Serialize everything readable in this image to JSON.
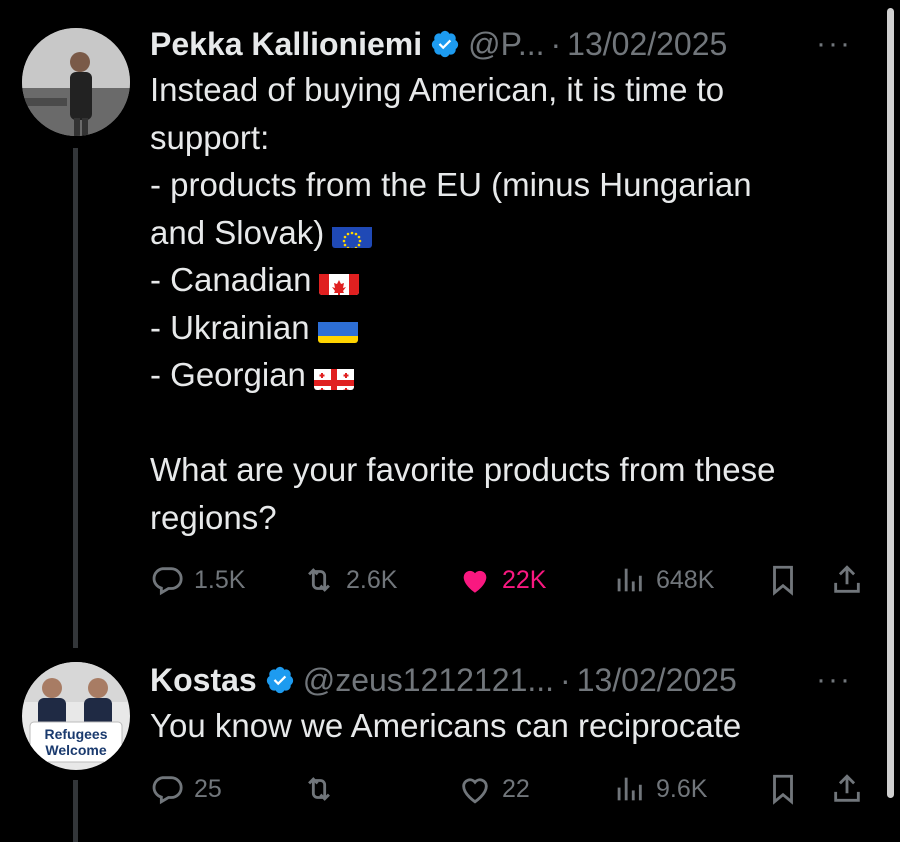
{
  "tweets": [
    {
      "name": "Pekka Kallioniemi",
      "handle": "@P...",
      "date": "13/02/2025",
      "more": "···",
      "lines": [
        "Instead of buying American, it is time to",
        "support:",
        "- products from the EU (minus Hungarian",
        "and Slovak)",
        "- Canadian",
        "- Ukrainian",
        "- Georgian",
        "",
        "What are your favorite products from these",
        "regions?"
      ],
      "replies": "1.5K",
      "reposts": "2.6K",
      "likes": "22K",
      "views": "648K",
      "liked": true
    },
    {
      "name": "Kostas",
      "handle": "@zeus1212121...",
      "date": "13/02/2025",
      "more": "···",
      "avatar_sign_line1": "Refugees",
      "avatar_sign_line2": "Welcome",
      "lines": [
        "You know we Americans can reciprocate"
      ],
      "replies": "25",
      "reposts": "",
      "likes": "22",
      "views": "9.6K",
      "liked": false
    }
  ],
  "colors": {
    "background": "#000000",
    "text": "#e7e9ea",
    "muted": "#71767b",
    "verified": "#1d9bf0",
    "like": "#f91880"
  },
  "icons": [
    "verified-badge-icon",
    "reply-icon",
    "repost-icon",
    "like-icon",
    "views-icon",
    "bookmark-icon",
    "share-icon",
    "more-icon",
    "eu-flag-icon",
    "canada-flag-icon",
    "ukraine-flag-icon",
    "georgia-flag-icon"
  ]
}
